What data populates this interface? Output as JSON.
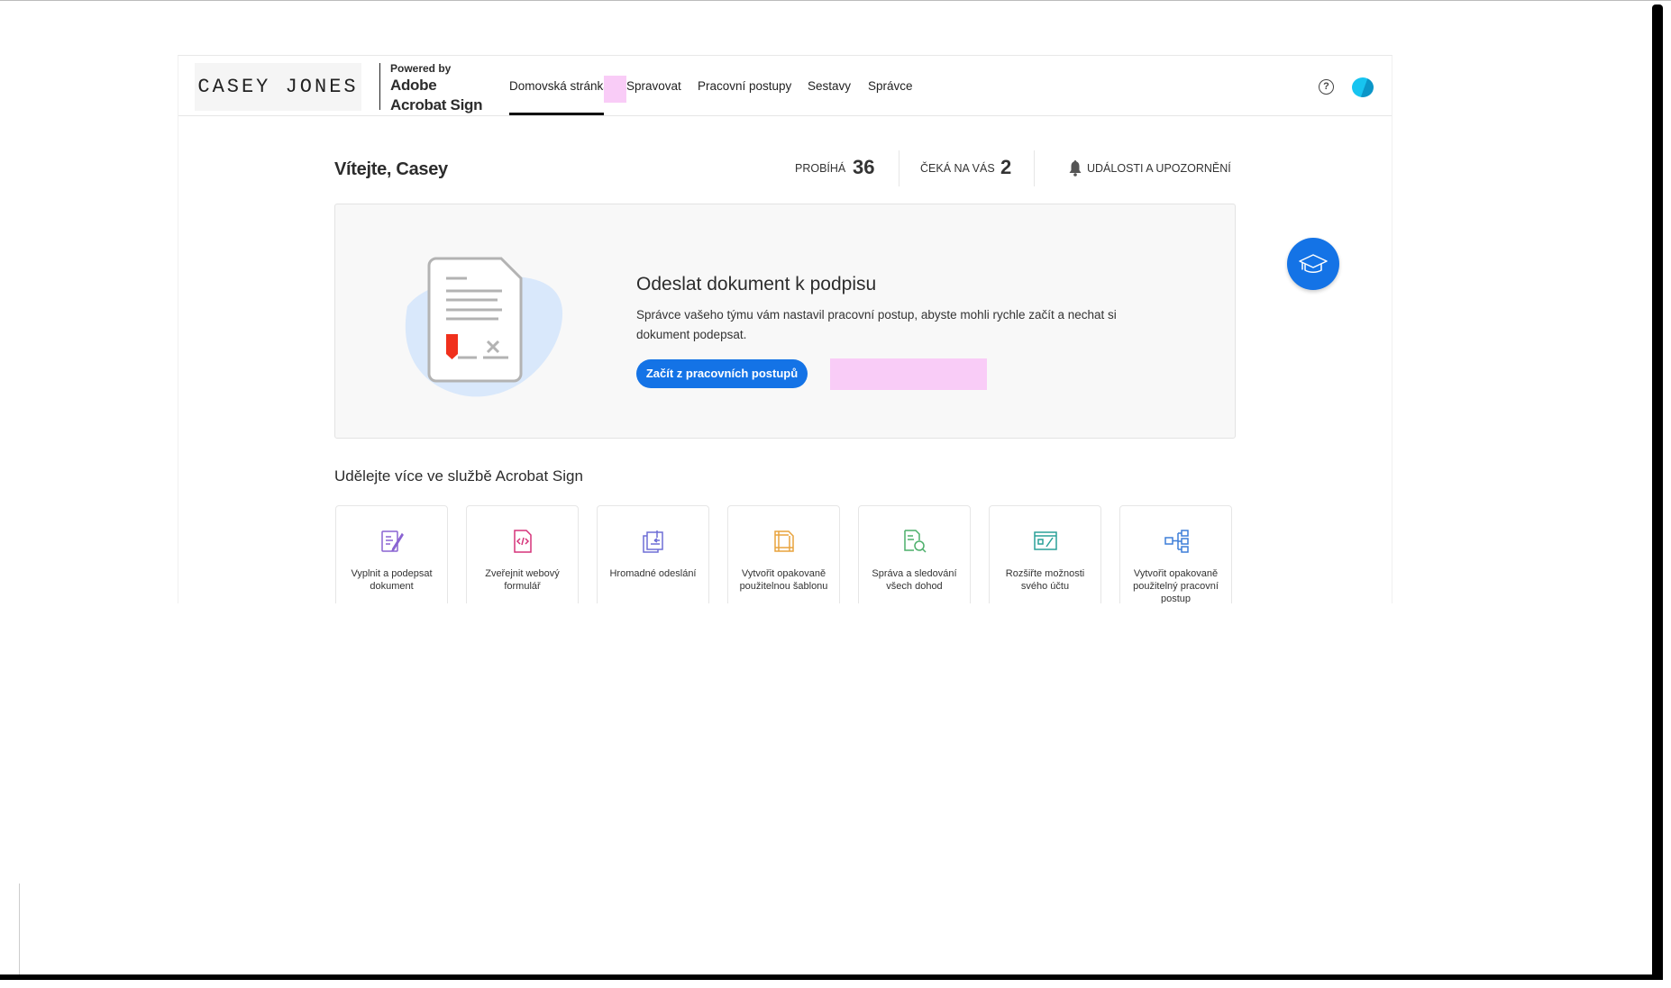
{
  "header": {
    "logo_text": "CASEY JONES",
    "powered_by": "Powered by",
    "brand_line1": "Adobe",
    "brand_line2": "Acrobat Sign",
    "nav": [
      {
        "label": "Domovská stránka",
        "active": true
      },
      {
        "label": "Spravovat"
      },
      {
        "label": "Pracovní postupy"
      },
      {
        "label": "Sestavy"
      },
      {
        "label": "Správce"
      }
    ],
    "help_glyph": "?"
  },
  "welcome": {
    "title": "Vítejte, Casey",
    "in_progress_label": "PROBÍHÁ",
    "in_progress_count": "36",
    "waiting_label": "ČEKÁ NA VÁS",
    "waiting_count": "2",
    "events_label": "UDÁLOSTI A UPOZORNĚNÍ"
  },
  "card": {
    "title": "Odeslat dokument k podpisu",
    "description": "Správce vašeho týmu vám nastavil pracovní postup, abyste mohli rychle začít a nechat si dokument podepsat.",
    "button_label": "Začít z pracovních postupů"
  },
  "more": {
    "title": "Udělejte více ve službě Acrobat Sign",
    "tiles": [
      {
        "label": "Vyplnit a podepsat dokument",
        "icon": "fill-sign-icon",
        "color": "#8a63d2"
      },
      {
        "label": "Zveřejnit webový formulář",
        "icon": "web-form-icon",
        "color": "#d6337a"
      },
      {
        "label": "Hromadné odeslání",
        "icon": "bulk-send-icon",
        "color": "#6e6ed6"
      },
      {
        "label": "Vytvořit opakovaně použitelnou šablonu",
        "icon": "template-icon",
        "color": "#e8a33d"
      },
      {
        "label": "Správa a sledování všech dohod",
        "icon": "manage-agreements-icon",
        "color": "#4caf6a"
      },
      {
        "label": "Rozšiřte možnosti svého účtu",
        "icon": "extend-account-icon",
        "color": "#2aa198"
      },
      {
        "label": "Vytvořit opakovaně použitelný pracovní postup",
        "icon": "workflow-icon",
        "color": "#3d7ed8"
      }
    ]
  },
  "colors": {
    "accent": "#1473e6",
    "highlight": "#f9ccf7"
  }
}
